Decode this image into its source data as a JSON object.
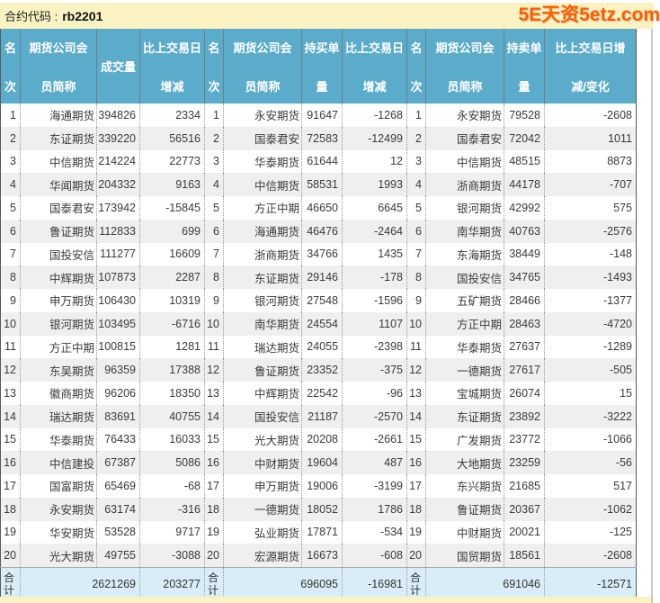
{
  "page": {
    "top_bar": {
      "contract_label": "合约代码 :",
      "contract_code": "rb2201",
      "logo_text": "5E天资5etz.com"
    },
    "colors": {
      "header_teal": "#5BACCB",
      "title_bar_yellow": "#FBF2C4",
      "total_row_blue": "#D8EDF8",
      "alt_row_gray": "#EFEFEF",
      "logo_orange": "#FF5C00",
      "header_text": "#FFFFFF",
      "body_text": "#3A3A3A"
    }
  },
  "table": {
    "column_headers": {
      "rank": [
        "名",
        "次"
      ],
      "member": [
        "期货公司会",
        "员简称"
      ],
      "volume": "成交量",
      "volume_change": [
        "比上交易日",
        "增减"
      ],
      "long": [
        "持买单",
        "量"
      ],
      "long_change": [
        "比上交易日",
        "增减"
      ],
      "short": [
        "持卖单",
        "量"
      ],
      "short_change": [
        "比上交易日增",
        "减/变化"
      ]
    },
    "total_label": [
      "合",
      "计"
    ],
    "groups": [
      {
        "metric": "成交量",
        "rows": [
          {
            "rank": 1,
            "member": "海通期货",
            "value": 394826,
            "change": 2334
          },
          {
            "rank": 2,
            "member": "东证期货",
            "value": 339220,
            "change": 56516
          },
          {
            "rank": 3,
            "member": "中信期货",
            "value": 214224,
            "change": 22773
          },
          {
            "rank": 4,
            "member": "华闻期货",
            "value": 204332,
            "change": 9163
          },
          {
            "rank": 5,
            "member": "国泰君安",
            "value": 173942,
            "change": -15845
          },
          {
            "rank": 6,
            "member": "鲁证期货",
            "value": 112833,
            "change": 699
          },
          {
            "rank": 7,
            "member": "国投安信",
            "value": 111277,
            "change": 16609
          },
          {
            "rank": 8,
            "member": "中辉期货",
            "value": 107873,
            "change": 2287
          },
          {
            "rank": 9,
            "member": "申万期货",
            "value": 106430,
            "change": 10319
          },
          {
            "rank": 10,
            "member": "银河期货",
            "value": 103495,
            "change": -6716
          },
          {
            "rank": 11,
            "member": "方正中期",
            "value": 100815,
            "change": 1281
          },
          {
            "rank": 12,
            "member": "东吴期货",
            "value": 96359,
            "change": 17388
          },
          {
            "rank": 13,
            "member": "徽商期货",
            "value": 96206,
            "change": 18350
          },
          {
            "rank": 14,
            "member": "瑞达期货",
            "value": 83691,
            "change": 40755
          },
          {
            "rank": 15,
            "member": "华泰期货",
            "value": 76433,
            "change": 16033
          },
          {
            "rank": 16,
            "member": "中信建投",
            "value": 67387,
            "change": 5086
          },
          {
            "rank": 17,
            "member": "国富期货",
            "value": 65469,
            "change": -68
          },
          {
            "rank": 18,
            "member": "永安期货",
            "value": 63174,
            "change": -316
          },
          {
            "rank": 19,
            "member": "华安期货",
            "value": 53528,
            "change": 9717
          },
          {
            "rank": 20,
            "member": "光大期货",
            "value": 49755,
            "change": -3088
          }
        ],
        "totals": {
          "value": 2621269,
          "change": 203277
        }
      },
      {
        "metric": "持买单量",
        "rows": [
          {
            "rank": 1,
            "member": "永安期货",
            "value": 91647,
            "change": -1268
          },
          {
            "rank": 2,
            "member": "国泰君安",
            "value": 72583,
            "change": -12499
          },
          {
            "rank": 3,
            "member": "华泰期货",
            "value": 61644,
            "change": 12
          },
          {
            "rank": 4,
            "member": "中信期货",
            "value": 58531,
            "change": 1993
          },
          {
            "rank": 5,
            "member": "方正中期",
            "value": 46650,
            "change": 6645
          },
          {
            "rank": 6,
            "member": "海通期货",
            "value": 46476,
            "change": -2464
          },
          {
            "rank": 7,
            "member": "浙商期货",
            "value": 34766,
            "change": 1435
          },
          {
            "rank": 8,
            "member": "东证期货",
            "value": 29146,
            "change": -178
          },
          {
            "rank": 9,
            "member": "银河期货",
            "value": 27548,
            "change": -1596
          },
          {
            "rank": 10,
            "member": "南华期货",
            "value": 24554,
            "change": 1107
          },
          {
            "rank": 11,
            "member": "瑞达期货",
            "value": 24055,
            "change": -2398
          },
          {
            "rank": 12,
            "member": "鲁证期货",
            "value": 23352,
            "change": -375
          },
          {
            "rank": 13,
            "member": "中辉期货",
            "value": 22542,
            "change": -96
          },
          {
            "rank": 14,
            "member": "国投安信",
            "value": 21187,
            "change": -2570
          },
          {
            "rank": 15,
            "member": "光大期货",
            "value": 20208,
            "change": -2661
          },
          {
            "rank": 16,
            "member": "中财期货",
            "value": 19604,
            "change": 487
          },
          {
            "rank": 17,
            "member": "申万期货",
            "value": 19006,
            "change": -3199
          },
          {
            "rank": 18,
            "member": "一德期货",
            "value": 18052,
            "change": 1786
          },
          {
            "rank": 19,
            "member": "弘业期货",
            "value": 17871,
            "change": -534
          },
          {
            "rank": 20,
            "member": "宏源期货",
            "value": 16673,
            "change": -608
          }
        ],
        "totals": {
          "value": 696095,
          "change": -16981
        }
      },
      {
        "metric": "持卖单量",
        "rows": [
          {
            "rank": 1,
            "member": "永安期货",
            "value": 79528,
            "change": -2608
          },
          {
            "rank": 2,
            "member": "国泰君安",
            "value": 72042,
            "change": 1011
          },
          {
            "rank": 3,
            "member": "中信期货",
            "value": 48515,
            "change": 8873
          },
          {
            "rank": 4,
            "member": "浙商期货",
            "value": 44178,
            "change": -707
          },
          {
            "rank": 5,
            "member": "银河期货",
            "value": 42992,
            "change": 575
          },
          {
            "rank": 6,
            "member": "南华期货",
            "value": 40763,
            "change": -2576
          },
          {
            "rank": 7,
            "member": "东海期货",
            "value": 38449,
            "change": -148
          },
          {
            "rank": 8,
            "member": "国投安信",
            "value": 34765,
            "change": -1493
          },
          {
            "rank": 9,
            "member": "五矿期货",
            "value": 28466,
            "change": -1377
          },
          {
            "rank": 10,
            "member": "方正中期",
            "value": 28463,
            "change": -4720
          },
          {
            "rank": 11,
            "member": "华泰期货",
            "value": 27637,
            "change": -1289
          },
          {
            "rank": 12,
            "member": "一德期货",
            "value": 27617,
            "change": -505
          },
          {
            "rank": 13,
            "member": "宝城期货",
            "value": 26074,
            "change": 15
          },
          {
            "rank": 14,
            "member": "东证期货",
            "value": 23892,
            "change": -3222
          },
          {
            "rank": 15,
            "member": "广发期货",
            "value": 23772,
            "change": -1066
          },
          {
            "rank": 16,
            "member": "大地期货",
            "value": 23259,
            "change": -56
          },
          {
            "rank": 17,
            "member": "东兴期货",
            "value": 21685,
            "change": 517
          },
          {
            "rank": 18,
            "member": "鲁证期货",
            "value": 20367,
            "change": -1062
          },
          {
            "rank": 19,
            "member": "中财期货",
            "value": 20021,
            "change": -125
          },
          {
            "rank": 20,
            "member": "国贸期货",
            "value": 18561,
            "change": -2608
          }
        ],
        "totals": {
          "value": 691046,
          "change": -12571
        }
      }
    ]
  }
}
